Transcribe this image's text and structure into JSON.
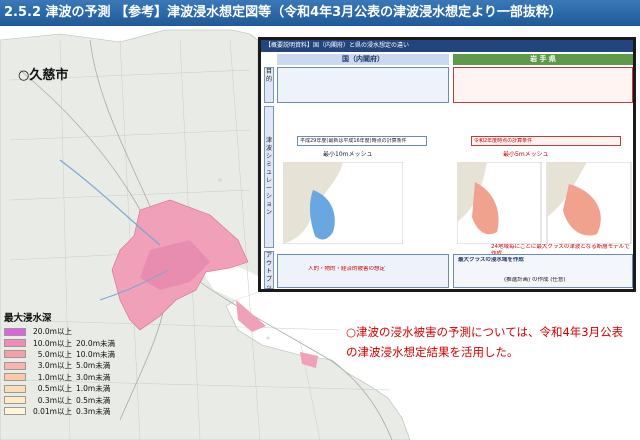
{
  "header": {
    "title": "2.5.2 津波の予測 【参考】津波浸水想定図等（令和4年3月公表の津波浸水想定より一部抜粋）"
  },
  "map": {
    "city_label": "○久慈市"
  },
  "inset": {
    "title": "【概要説明資料】国（内閣府）と県の浸水想定の違い",
    "col_national": "国（内閣府）",
    "col_prefecture": "岩 手 県",
    "side_labels": [
      "目的",
      "津波シミュレーション",
      "アウトプット"
    ],
    "nat_mesh": "最小10mメッシュ",
    "pref_mesh": "最小5mメッシュ",
    "nat_model": "平成29年度(最新は平成16年度)時点の計算条件",
    "pref_model": "令和2年度時点の計算条件",
    "pref_result": "最大クラスの浸水域を作成",
    "pref_output": "24地域毎にごとに最大クラスの津波となる断層モデルで作成",
    "nat_output": "人的・物的・経済的被害の想定",
    "pref_output2": "(推進計画) の作成 (任意)"
  },
  "legend": {
    "title": "最大浸水深",
    "items": [
      {
        "color": "#dc64dc",
        "low": "20.0m以上",
        "high": ""
      },
      {
        "color": "#f08cb8",
        "low": "10.0m以上",
        "high": "20.0m未満"
      },
      {
        "color": "#f5a0a8",
        "low": "5.0m以上",
        "high": "10.0m未満"
      },
      {
        "color": "#f8b4ae",
        "low": "3.0m以上",
        "high": "5.0m未満"
      },
      {
        "color": "#fbc8a8",
        "low": "1.0m以上",
        "high": "3.0m未満"
      },
      {
        "color": "#fcdcb4",
        "low": "0.5m以上",
        "high": "1.0m未満"
      },
      {
        "color": "#fdecc4",
        "low": "0.3m以上",
        "high": "0.5m未満"
      },
      {
        "color": "#fef6d8",
        "low": "0.01m以上",
        "high": "0.3m未満"
      }
    ]
  },
  "note": {
    "text": "○津波の浸水被害の予測については、令和4年3月公表の津波浸水想定結果を活用した。"
  }
}
